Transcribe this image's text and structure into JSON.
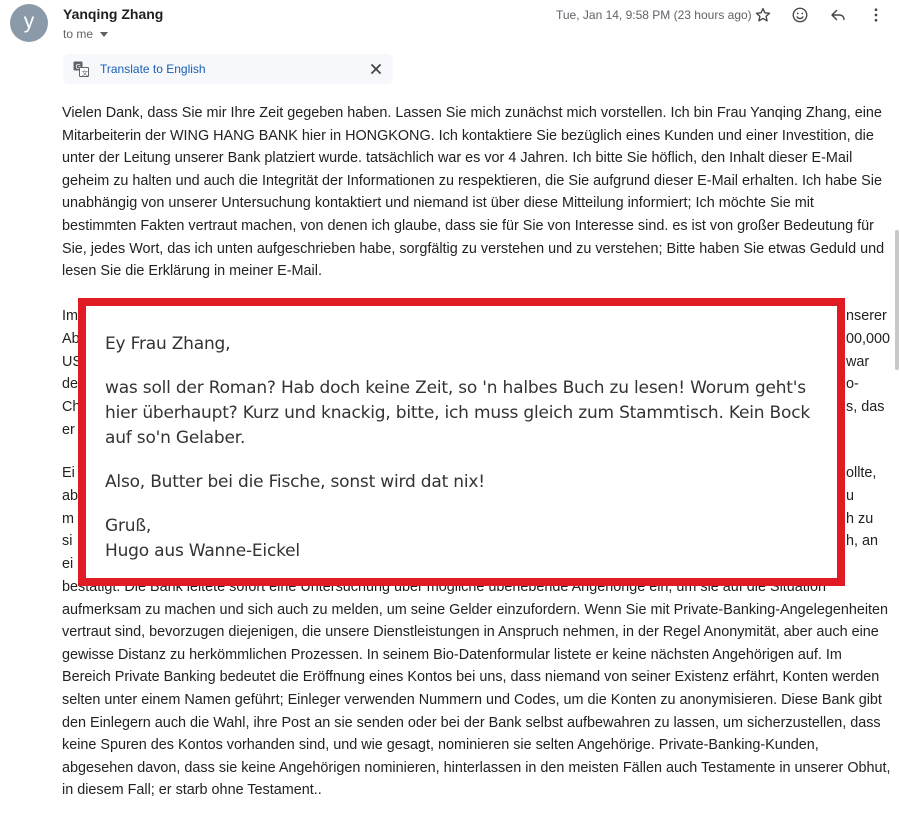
{
  "header": {
    "avatar_letter": "y",
    "sender_name": "Yanqing Zhang",
    "recipient": "to me",
    "date": "Tue, Jan 14, 9:58 PM (23 hours ago)",
    "icons": [
      "star-icon",
      "emoji-icon",
      "reply-icon",
      "more-vert-icon"
    ]
  },
  "translate_bar": {
    "label": "Translate to English",
    "icon": "translate-icon",
    "close_icon": "close-icon"
  },
  "body": {
    "paragraph1": "Vielen Dank, dass Sie mir Ihre Zeit gegeben haben. Lassen Sie mich zunächst mich vorstellen. Ich bin Frau Yanqing Zhang, eine Mitarbeiterin der WING HANG BANK hier in HONGKONG. Ich kontaktiere Sie bezüglich eines Kunden und einer Investition, die unter der Leitung unserer Bank platziert wurde. tatsächlich war es vor 4 Jahren. Ich bitte Sie höflich, den Inhalt dieser E-Mail geheim zu halten und auch die Integrität der Informationen zu respektieren, die Sie aufgrund dieser E-Mail erhalten. Ich habe Sie unabhängig von unserer Untersuchung kontaktiert und niemand ist über diese Mitteilung informiert; Ich möchte Sie mit bestimmten Fakten vertraut machen, von denen ich glaube, dass sie für Sie von Interesse sind. es ist von großer Bedeutung für Sie, jedes Wort, das ich unten aufgeschrieben habe, sorgfältig zu verstehen und zu verstehen; Bitte haben Sie etwas Geduld und lesen Sie die Erklärung in meiner E-Mail.",
    "paragraph2_visible_fragments": [
      "Im",
      "nserer",
      "Ab",
      "00,000",
      "US",
      "war",
      "de",
      "o-",
      "Ch",
      "s, das",
      "er"
    ],
    "paragraph3_visible_fragments": [
      "Ei",
      "ollte,",
      "ab",
      "u",
      "m",
      "h zu",
      "si",
      "h, an",
      "ei"
    ],
    "paragraph3_tail": "bestätigt. Die Bank leitete sofort eine Untersuchung über mögliche überlebende Angehörige ein, um sie auf die Situation aufmerksam zu machen und sich auch zu melden, um seine Gelder einzufordern. Wenn Sie mit Private-Banking-Angelegenheiten vertraut sind, bevorzugen diejenigen, die unsere Dienstleistungen in Anspruch nehmen, in der Regel Anonymität, aber auch eine gewisse Distanz zu herkömmlichen Prozessen. In seinem Bio-Datenformular listete er keine nächsten Angehörigen auf. Im Bereich Private Banking bedeutet die Eröffnung eines Kontos bei uns, dass niemand von seiner Existenz erfährt, Konten werden selten unter einem Namen geführt; Einleger verwenden Nummern und Codes, um die Konten zu anonymisieren. Diese Bank gibt den Einlegern auch die Wahl, ihre Post an sie senden oder bei der Bank selbst aufbewahren zu lassen, um sicherzustellen, dass keine Spuren des Kontos vorhanden sind, und wie gesagt, nominieren sie selten Angehörige. Private-Banking-Kunden, abgesehen davon, dass sie keine Angehörigen nominieren, hinterlassen in den meisten Fällen auch Testamente in unserer Obhut, in diesem Fall; er starb ohne Testament.."
  },
  "overlay_reply": {
    "greeting": "Ey Frau Zhang,",
    "line1": "was soll der Roman? Hab doch keine Zeit, so 'n halbes Buch zu lesen! Worum geht's hier überhaupt? Kurz und knackig, bitte, ich muss gleich zum Stammtisch. Kein Bock auf so'n Gelaber.",
    "line2": "Also, Butter bei die Fische, sonst wird dat nix!",
    "closing": "Gruß,",
    "signature": "Hugo aus Wanne-Eickel",
    "border_color": "#e01b24"
  }
}
